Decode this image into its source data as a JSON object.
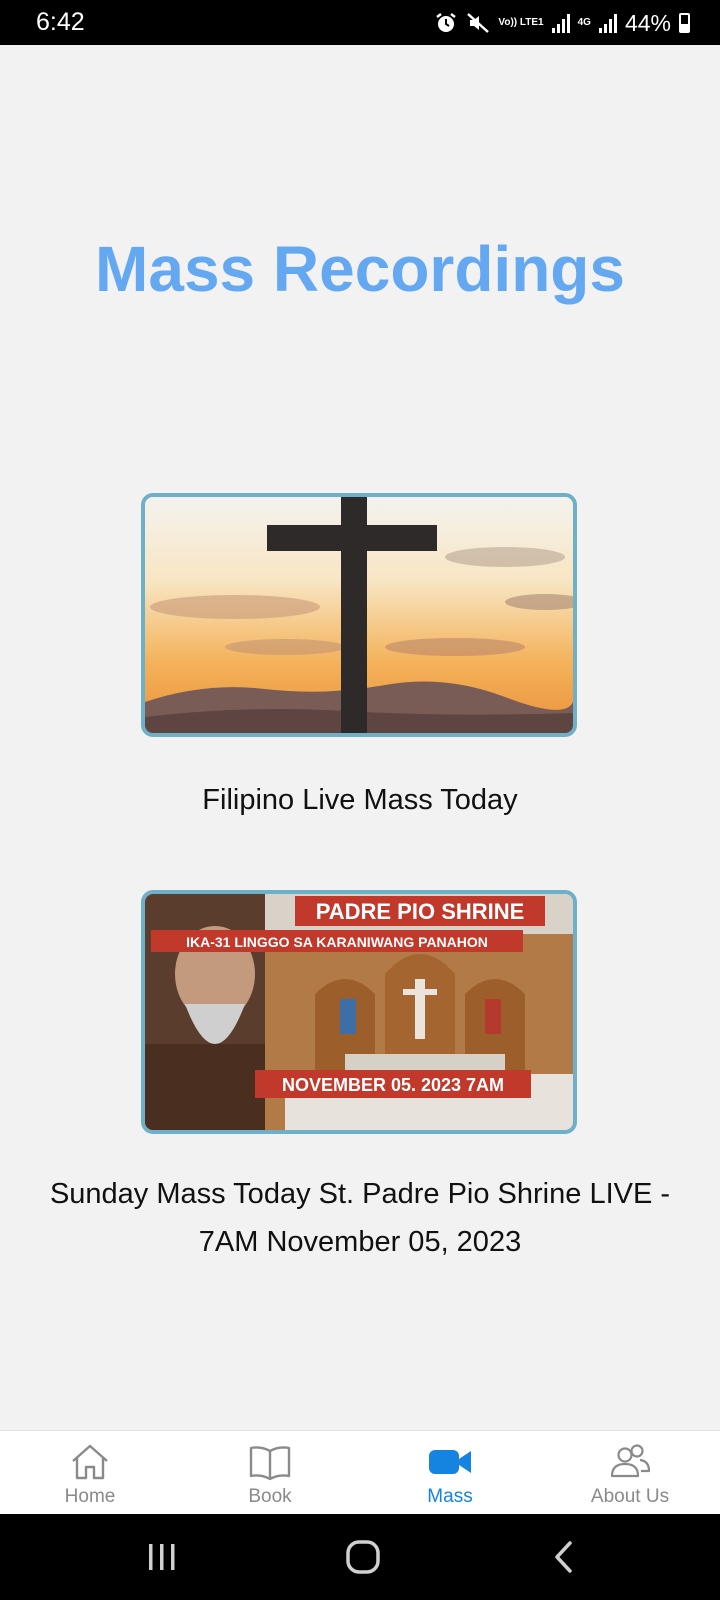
{
  "status_bar": {
    "time": "6:42",
    "battery": "44%",
    "net_top": "Vo)) LTE1",
    "net_4g": "4G",
    "icons": [
      "alarm-icon",
      "mute-icon",
      "signal-icon",
      "battery-icon"
    ]
  },
  "page": {
    "title": "Mass Recordings"
  },
  "recordings": [
    {
      "caption": "Filipino Live Mass Today",
      "thumbnail": "cross-sunset-thumbnail"
    },
    {
      "caption": "Sunday Mass Today St. Padre Pio Shrine  LIVE - 7AM November 05, 2023",
      "thumbnail": "padre-pio-shrine-thumbnail",
      "thumb_text": {
        "line1": "PADRE PIO SHRINE",
        "line2": "IKA-31 LINGGO SA KARANIWANG PANAHON",
        "line3": "NOVEMBER 05. 2023 7AM"
      }
    }
  ],
  "bottom_nav": {
    "active": "Mass",
    "accent_color": "#1583e0",
    "items": [
      {
        "label": "Home",
        "icon": "home-icon"
      },
      {
        "label": "Book",
        "icon": "book-icon"
      },
      {
        "label": "Mass",
        "icon": "video-camera-icon"
      },
      {
        "label": "About Us",
        "icon": "people-icon"
      }
    ]
  },
  "system_nav": {
    "buttons": [
      "recents-button",
      "home-button",
      "back-button"
    ]
  }
}
